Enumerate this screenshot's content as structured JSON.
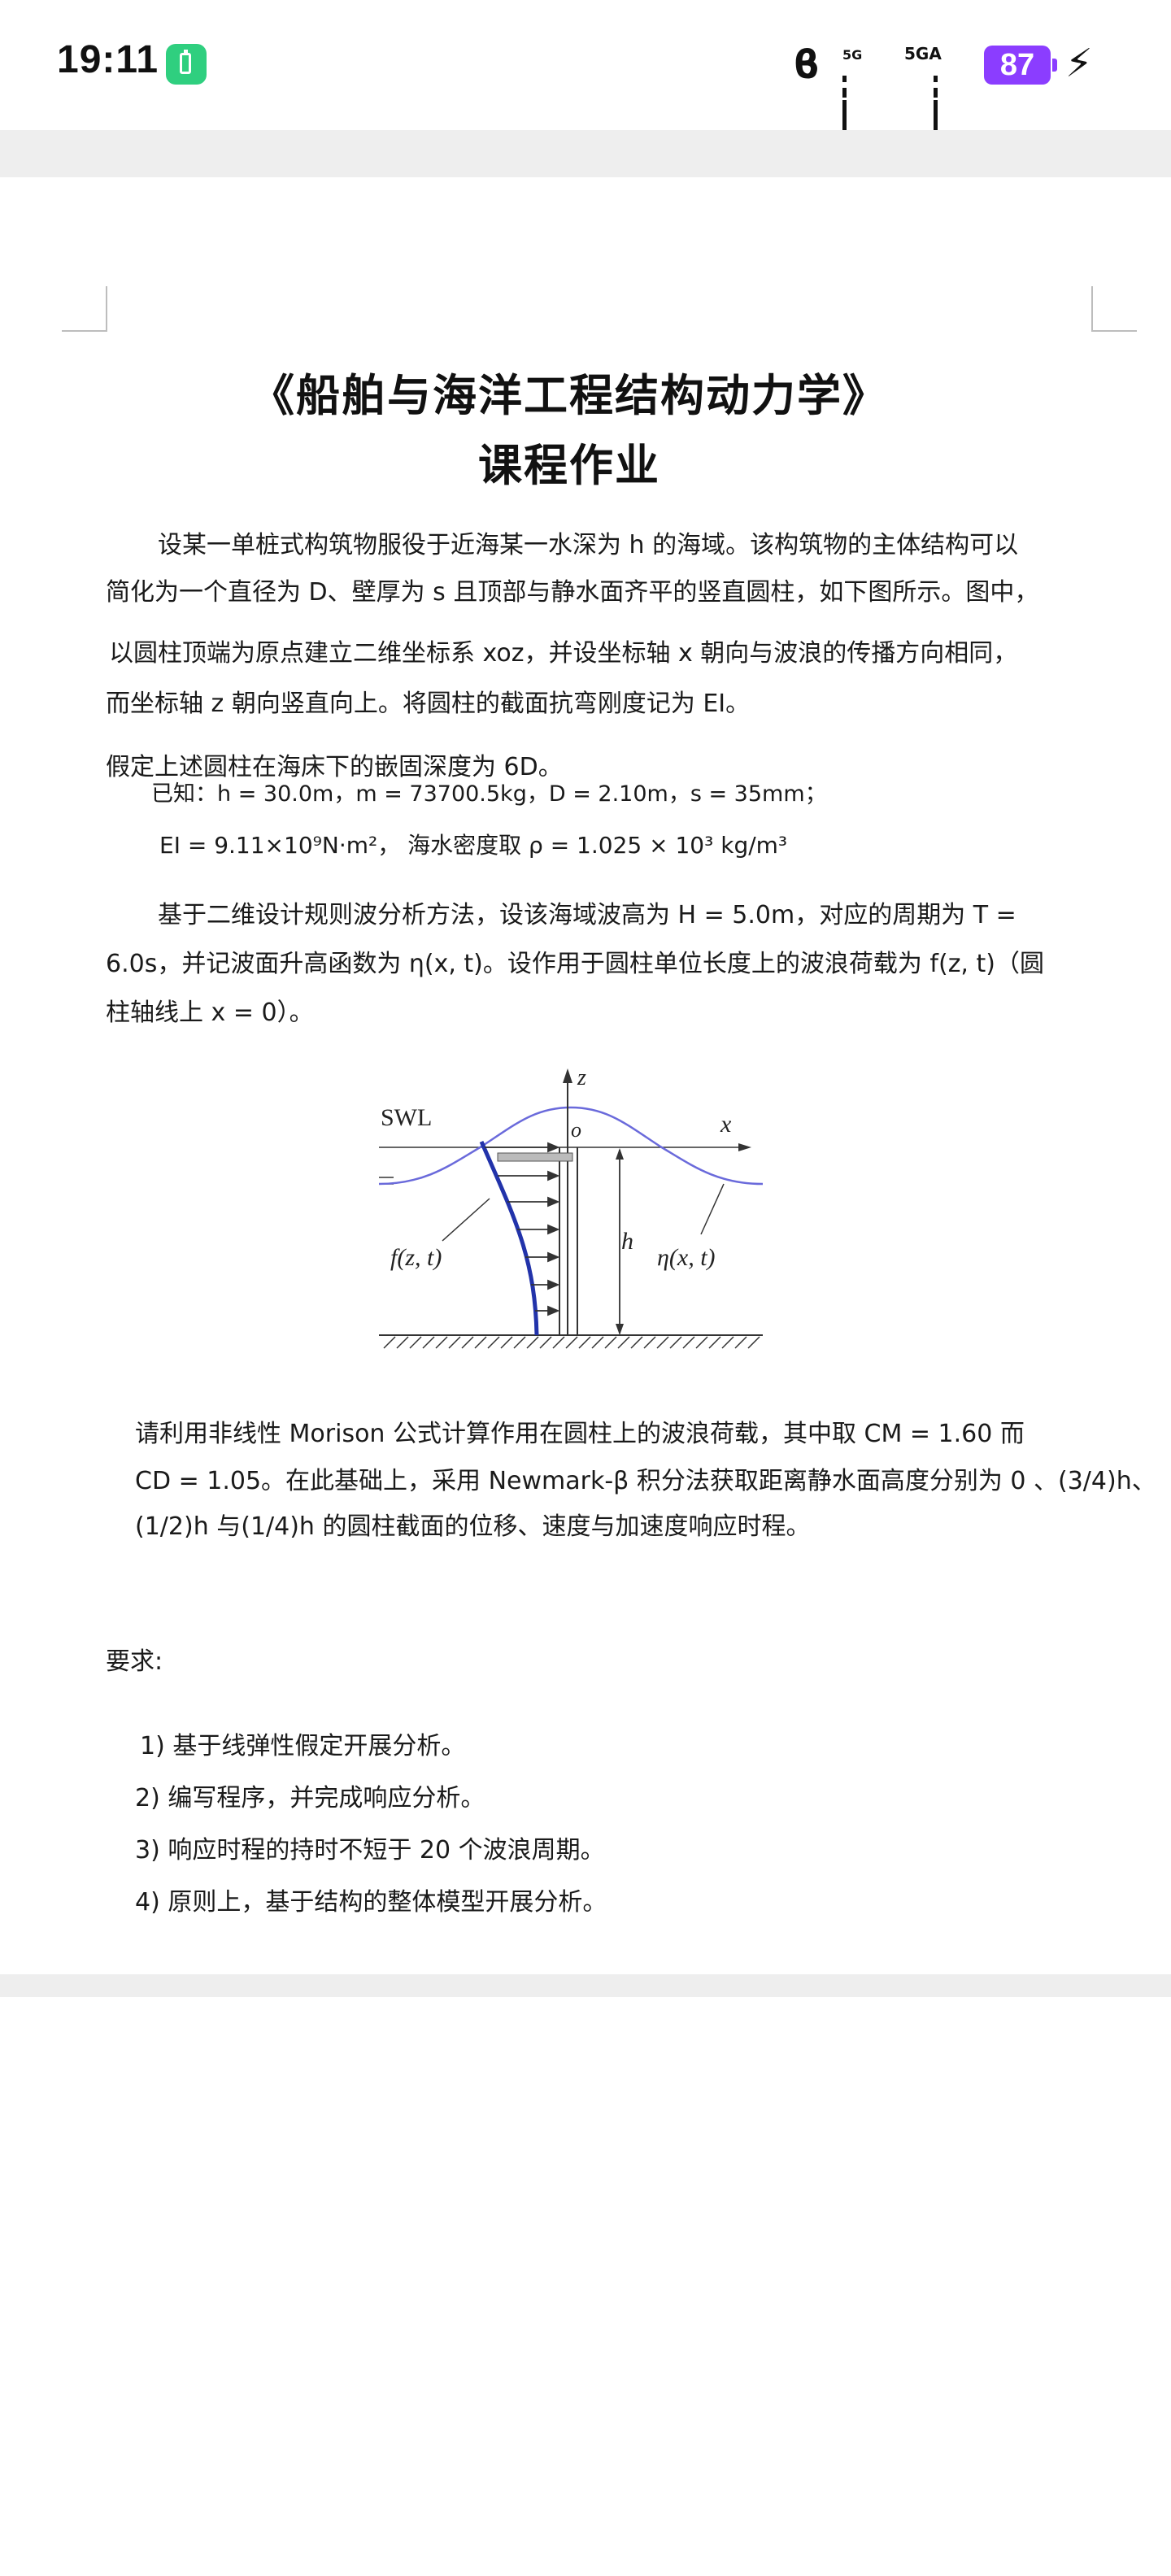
{
  "status_bar": {
    "time": "19:11",
    "network1": "5G",
    "network2": "5GA",
    "battery": "87",
    "icons": [
      "battery-saver-icon",
      "bluetooth-icon",
      "signal-icon",
      "signal-icon",
      "charging-icon"
    ]
  },
  "document": {
    "title": "《船舶与海洋工程结构动力学》",
    "subtitle": "课程作业",
    "intro": [
      "设某一单桩式构筑物服役于近海某一水深为 h 的海域。该构筑物的主体结构可以",
      "简化为一个直径为 D、壁厚为 s 且顶部与静水面齐平的竖直圆柱，如下图所示。图中，",
      "以圆柱顶端为原点建立二维坐标系 xoz，并设坐标轴 x 朝向与波浪的传播方向相同，",
      "而坐标轴 z 朝向竖直向上。将圆柱的截面抗弯刚度记为 EI。"
    ],
    "embed": "假定上述圆柱在海床下的嵌固深度为 6D。",
    "known": "已知：h = 30.0m，m = 73700.5kg，D = 2.10m，s = 35mm；",
    "ei": "EI = 9.11×10⁹N·m²， 海水密度取 ρ = 1.025 × 10³ kg/m³",
    "wave": [
      "基于二维设计规则波分析方法，设该海域波高为 H = 5.0m，对应的周期为 T =",
      "6.0s，并记波面升高函数为 η(x, t)。设作用于圆柱单位长度上的波浪荷载为 f(z, t)（圆",
      "柱轴线上 x = 0）。"
    ],
    "figure": {
      "swl": "SWL",
      "z": "z",
      "o": "o",
      "x": "x",
      "h": "h",
      "f": "f(z, t)",
      "eta": "η(x, t)"
    },
    "morison": [
      "请利用非线性 Morison 公式计算作用在圆柱上的波浪荷载，其中取 CM = 1.60 而",
      "CD = 1.05。在此基础上，采用 Newmark-β 积分法获取距离静水面高度分别为 0 、(3/4)h、",
      "(1/2)h 与(1/4)h 的圆柱截面的位移、速度与加速度响应时程。"
    ],
    "req_title": "要求:",
    "requirements": [
      "1) 基于线弹性假定开展分析。",
      "2) 编写程序，并完成响应分析。",
      "3) 响应时程的持时不短于 20 个波浪周期。",
      "4) 原则上，基于结构的整体模型开展分析。"
    ]
  }
}
